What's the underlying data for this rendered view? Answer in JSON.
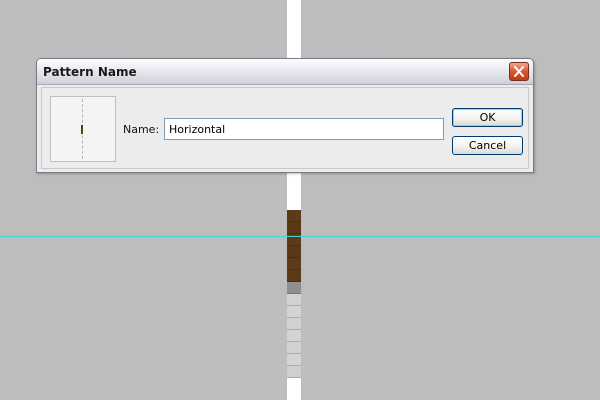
{
  "dialog": {
    "title": "Pattern Name",
    "name_label": "Name:",
    "name_value": "Horizontal",
    "ok_label": "OK",
    "cancel_label": "Cancel"
  },
  "icons": {
    "close": "close-icon"
  },
  "colors": {
    "canvas_gray": "#bdbdbd",
    "guide_cyan": "#45d6d6",
    "pixel_brown": "#5d3b19",
    "close_button_red": "#d9562f"
  },
  "pixel_column": {
    "cells": [
      "#5d3b19",
      "#5a3816",
      "#5d3b19",
      "#5b3917",
      "#5d3b19",
      "#5c3a18",
      "#8f8f8f",
      "#d2d2d2",
      "#d4d4d4",
      "#d2d2d2",
      "#d4d4d4",
      "#d2d2d2",
      "#d4d4d4",
      "#cfcfcf"
    ]
  }
}
